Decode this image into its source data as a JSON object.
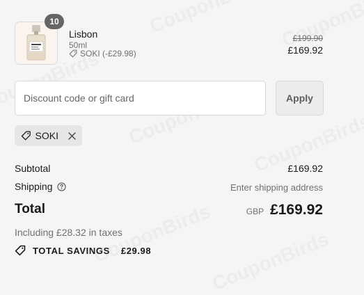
{
  "watermark": "CouponBirds",
  "product": {
    "quantity": "10",
    "name": "Lisbon",
    "variant": "50ml",
    "discount_line": "SOKI (-£29.98)",
    "original_price": "£199.90",
    "price": "£169.92",
    "image_icon": "perfume-bottle-icon",
    "bottle_label": "LE LABO"
  },
  "discount": {
    "placeholder": "Discount code or gift card",
    "apply_label": "Apply",
    "applied_code": "SOKI",
    "tag_icon": "tag-icon",
    "remove_icon": "close-icon"
  },
  "summary": {
    "subtotal_label": "Subtotal",
    "subtotal_value": "£169.92",
    "shipping_label": "Shipping",
    "shipping_value": "Enter shipping address",
    "shipping_help_icon": "help-circle-icon",
    "total_label": "Total",
    "currency": "GBP",
    "total_value": "£169.92",
    "tax_line": "Including £28.32 in taxes",
    "savings_label": "TOTAL SAVINGS",
    "savings_value": "£29.98",
    "savings_icon": "tag-icon"
  },
  "colors": {
    "background": "#f5f5f5",
    "badge": "#666666",
    "muted_text": "#707070",
    "chip_bg": "#e6e6e6"
  }
}
